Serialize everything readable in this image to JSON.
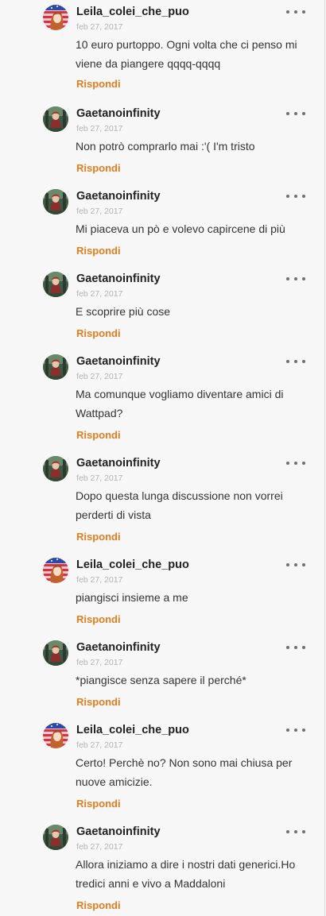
{
  "comments": [
    {
      "user": "Leila_colei_che_puo",
      "avatar": "leila",
      "date": "feb 27, 2017",
      "text": "10 euro purtoppo. Ogni volta che ci penso mi viene da piangere qqqq-qqqq",
      "reply": "Rispondi"
    },
    {
      "user": "Gaetanoinfinity",
      "avatar": "gaetano",
      "date": "feb 27, 2017",
      "text": "Non potrò comprarlo mai :'( I'm tristo",
      "reply": "Rispondi"
    },
    {
      "user": "Gaetanoinfinity",
      "avatar": "gaetano",
      "date": "feb 27, 2017",
      "text": "Mi piaceva un pò e volevo capircene di più",
      "reply": "Rispondi"
    },
    {
      "user": "Gaetanoinfinity",
      "avatar": "gaetano",
      "date": "feb 27, 2017",
      "text": "E scoprire più cose",
      "reply": "Rispondi"
    },
    {
      "user": "Gaetanoinfinity",
      "avatar": "gaetano",
      "date": "feb 27, 2017",
      "text": "Ma comunque vogliamo diventare amici di Wattpad?",
      "reply": "Rispondi"
    },
    {
      "user": "Gaetanoinfinity",
      "avatar": "gaetano",
      "date": "feb 27, 2017",
      "text": "Dopo questa lunga discussione non vorrei perderti di vista",
      "reply": "Rispondi"
    },
    {
      "user": "Leila_colei_che_puo",
      "avatar": "leila",
      "date": "feb 27, 2017",
      "text": "piangisci insieme a me",
      "reply": "Rispondi"
    },
    {
      "user": "Gaetanoinfinity",
      "avatar": "gaetano",
      "date": "feb 27, 2017",
      "text": "*piangisce senza sapere il perché*",
      "reply": "Rispondi"
    },
    {
      "user": "Leila_colei_che_puo",
      "avatar": "leila",
      "date": "feb 27, 2017",
      "text": "Certo! Perchè no? Non sono mai chiusa per nuove amicizie.",
      "reply": "Rispondi"
    },
    {
      "user": "Gaetanoinfinity",
      "avatar": "gaetano",
      "date": "feb 27, 2017",
      "text": "Allora iniziamo a dire i nostri dati generici.Ho tredici anni e vivo a Maddaloni",
      "reply": "Rispondi"
    }
  ],
  "colors": {
    "reply": "#e17d1e",
    "username": "#222222",
    "date": "#b3b3b3",
    "body": "#333333"
  }
}
